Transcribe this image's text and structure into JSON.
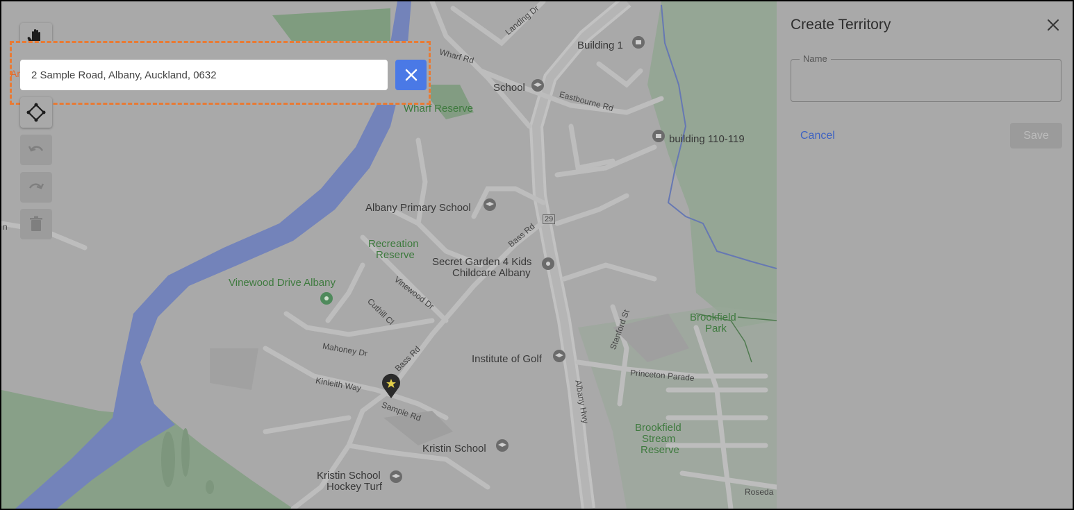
{
  "map": {
    "places": {
      "building1": "Building 1",
      "school": "School",
      "building110": "building 110-119",
      "albany_primary": "Albany Primary School",
      "secret_garden": "Secret Garden 4 Kids",
      "secret_garden_2": "Childcare Albany",
      "institute_golf": "Institute of Golf",
      "kristin_school": "Kristin School",
      "kristin_turf": "Kristin School",
      "kristin_turf_2": "Hockey Turf"
    },
    "parks": {
      "wharf_reserve": "Wharf Reserve",
      "recreation_reserve": "Recreation",
      "recreation_reserve_2": "Reserve",
      "vinewood": "Vinewood Drive Albany",
      "brookfield_park": "Brookfield",
      "brookfield_park_2": "Park",
      "brookfield_stream": "Brookfield",
      "brookfield_stream_2": "Stream",
      "brookfield_stream_3": "Reserve"
    },
    "roads": {
      "landing": "Landing Dr",
      "wharf": "Wharf Rd",
      "eastbourne": "Eastbourne Rd",
      "bass_upper": "Bass Rd",
      "bass_lower": "Bass Rd",
      "route": "29",
      "vinewood_dr": "Vinewood Dr",
      "cuthill": "Cuthill Cl",
      "mahoney": "Mahoney Dr",
      "kinleith": "Kinleith Way",
      "sample": "Sample Rd",
      "stanford": "Stanford St",
      "princeton": "Princeton Parade",
      "albany_hwy": "Albany Hwy",
      "roseda": "Roseda",
      "edge_n": "n",
      "edge_ar": "Ar"
    }
  },
  "toolbar": {
    "hand_icon": "hand-icon",
    "polygon_icon": "polygon-icon",
    "undo_icon": "undo-icon",
    "redo_icon": "redo-icon",
    "delete_icon": "trash-icon"
  },
  "search": {
    "value": "2 Sample Road, Albany, Auckland, 0632",
    "clear_icon": "close-icon",
    "highlight_color": "#e97a33",
    "button_color": "#4a79e6"
  },
  "panel": {
    "title": "Create Territory",
    "name_label": "Name",
    "name_value": "",
    "cancel_label": "Cancel",
    "save_label": "Save",
    "close_icon": "close-icon"
  }
}
